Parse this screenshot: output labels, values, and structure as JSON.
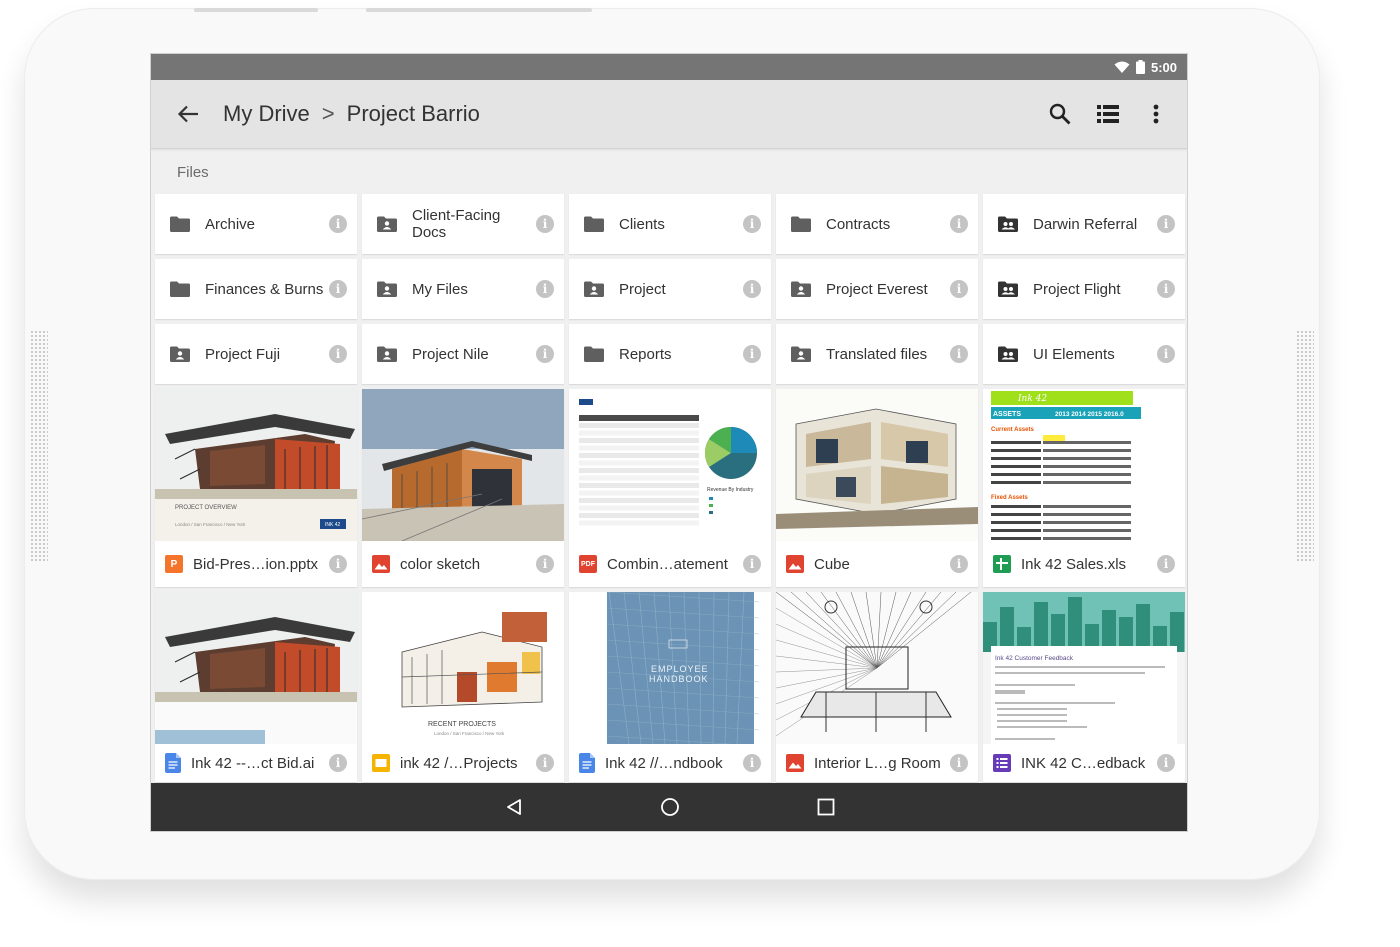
{
  "status_bar": {
    "time": "5:00"
  },
  "app_bar": {
    "root_title": "My Drive",
    "separator": ">",
    "folder_title": "Project Barrio"
  },
  "section": {
    "files_label": "Files"
  },
  "folders": [
    {
      "name": "Archive",
      "icon": "folder-icon"
    },
    {
      "name": "Client-Facing Docs",
      "icon": "shared-folder-icon"
    },
    {
      "name": "Clients",
      "icon": "folder-icon"
    },
    {
      "name": "Contracts",
      "icon": "folder-icon"
    },
    {
      "name": "Darwin Referral",
      "icon": "team-drive-icon"
    },
    {
      "name": "Finances & Burns",
      "icon": "folder-icon"
    },
    {
      "name": "My Files",
      "icon": "shared-folder-icon"
    },
    {
      "name": "Project",
      "icon": "shared-folder-icon"
    },
    {
      "name": "Project Everest",
      "icon": "shared-folder-icon"
    },
    {
      "name": "Project Flight",
      "icon": "team-drive-icon"
    },
    {
      "name": "Project Fuji",
      "icon": "shared-folder-icon"
    },
    {
      "name": "Project Nile",
      "icon": "shared-folder-icon"
    },
    {
      "name": "Reports",
      "icon": "folder-icon"
    },
    {
      "name": "Translated files",
      "icon": "shared-folder-icon"
    },
    {
      "name": "UI Elements",
      "icon": "team-drive-icon"
    }
  ],
  "files": [
    {
      "name": "Bid-Pres…ion.pptx",
      "type": "slides",
      "type_label": "P",
      "color": "#f4742b"
    },
    {
      "name": "color sketch",
      "type": "image",
      "type_label": "",
      "color": "#e0432f"
    },
    {
      "name": "Combin…atement",
      "type": "pdf",
      "type_label": "PDF",
      "color": "#e0432f"
    },
    {
      "name": "Cube",
      "type": "image",
      "type_label": "",
      "color": "#e0432f"
    },
    {
      "name": "Ink 42 Sales.xls",
      "type": "sheets",
      "type_label": "",
      "color": "#1f9d55"
    },
    {
      "name": "Ink 42 --…ct Bid.ai",
      "type": "docs",
      "type_label": "",
      "color": "#4a86e8"
    },
    {
      "name": "ink 42 /…Projects",
      "type": "slides-yellow",
      "type_label": "",
      "color": "#f4b400"
    },
    {
      "name": "Ink 42 //…ndbook",
      "type": "docs",
      "type_label": "",
      "color": "#4a86e8"
    },
    {
      "name": "Interior L…g Room",
      "type": "image",
      "type_label": "",
      "color": "#e0432f"
    },
    {
      "name": "INK 42 C…edback",
      "type": "forms",
      "type_label": "",
      "color": "#673ab7"
    }
  ],
  "thumb_text": {
    "project_overview": "PROJECT OVERVIEW",
    "overview_sub": "London / San Francisco / New York",
    "ink42_badge": "INK 42",
    "revenue_by_industry": "Revenue By Industry",
    "sheet_brand": "Ink 42",
    "assets": "ASSETS",
    "years": "2013 2014 2015 2016.0",
    "current_assets": "Current Assets",
    "fixed_assets": "Fixed Assets",
    "recent_projects": "RECENT PROJECTS",
    "recent_sub": "London / San Francisco / New York",
    "handbook_line1": "EMPLOYEE",
    "handbook_line2": "HANDBOOK",
    "feedback_title": "Ink 42 Customer Feedback"
  },
  "colors": {
    "status_bar": "#757575",
    "app_bar": "#e4e4e4",
    "nav_bar": "#333333",
    "sheet_header": "#1aa3b8",
    "sheet_brand_bar": "#9fe01a"
  }
}
